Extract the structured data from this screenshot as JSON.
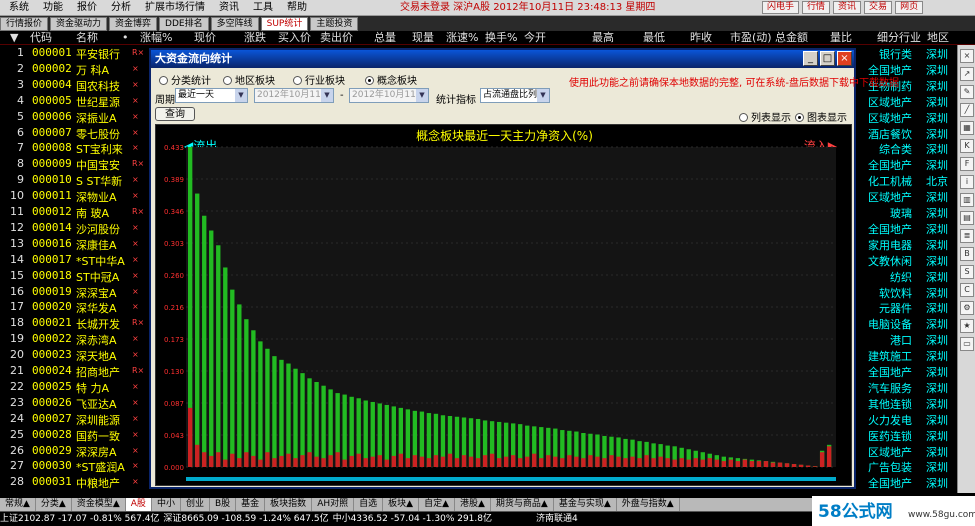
{
  "menubar": {
    "items": [
      "系统",
      "功能",
      "报价",
      "分析",
      "扩展市场行情",
      "资讯",
      "工具",
      "帮助"
    ],
    "status": "交易未登录  深沪A股  2012年10月11日  23:48:13  星期四",
    "buttons": [
      "闪电手",
      "行情",
      "资讯",
      "交易",
      "网页"
    ],
    "site": "www.55188.com"
  },
  "tabs": [
    "行情报价",
    "资金驱动力",
    "资金博弈",
    "DDE排名",
    "多空阵线",
    "SUP统计",
    "主题投资"
  ],
  "active_tab": 5,
  "list_header": {
    "cols": [
      "代码",
      "名称",
      "•",
      "涨幅%",
      "现价",
      "涨跌",
      "买入价",
      "卖出价",
      "总量",
      "现量",
      "涨速%",
      "换手%",
      "今开",
      "最高",
      "最低",
      "昨收",
      "市盈(动)",
      "总金额",
      "量比",
      "细分行业",
      "地区"
    ]
  },
  "stocks": [
    {
      "n": "1",
      "code": "000001",
      "name": "平安银行",
      "flag": "R×"
    },
    {
      "n": "2",
      "code": "000002",
      "name": "万 科A",
      "flag": "×"
    },
    {
      "n": "3",
      "code": "000004",
      "name": "国农科技",
      "flag": "×"
    },
    {
      "n": "4",
      "code": "000005",
      "name": "世纪星源",
      "flag": "×"
    },
    {
      "n": "5",
      "code": "000006",
      "name": "深振业A",
      "flag": "×"
    },
    {
      "n": "6",
      "code": "000007",
      "name": "零七股份",
      "flag": "×"
    },
    {
      "n": "7",
      "code": "000008",
      "name": "ST宝利来",
      "flag": "×"
    },
    {
      "n": "8",
      "code": "000009",
      "name": "中国宝安",
      "flag": "R×"
    },
    {
      "n": "9",
      "code": "000010",
      "name": "S ST华新",
      "flag": "×"
    },
    {
      "n": "10",
      "code": "000011",
      "name": "深物业A",
      "flag": "×"
    },
    {
      "n": "11",
      "code": "000012",
      "name": "南 玻A",
      "flag": "R×"
    },
    {
      "n": "12",
      "code": "000014",
      "name": "沙河股份",
      "flag": "×"
    },
    {
      "n": "13",
      "code": "000016",
      "name": "深康佳A",
      "flag": "×"
    },
    {
      "n": "14",
      "code": "000017",
      "name": "*ST中华A",
      "flag": "×"
    },
    {
      "n": "15",
      "code": "000018",
      "name": "ST中冠A",
      "flag": "×"
    },
    {
      "n": "16",
      "code": "000019",
      "name": "深深宝A",
      "flag": "×"
    },
    {
      "n": "17",
      "code": "000020",
      "name": "深华发A",
      "flag": "×"
    },
    {
      "n": "18",
      "code": "000021",
      "name": "长城开发",
      "flag": "R×"
    },
    {
      "n": "19",
      "code": "000022",
      "name": "深赤湾A",
      "flag": "×"
    },
    {
      "n": "20",
      "code": "000023",
      "name": "深天地A",
      "flag": "×"
    },
    {
      "n": "21",
      "code": "000024",
      "name": "招商地产",
      "flag": "R×"
    },
    {
      "n": "22",
      "code": "000025",
      "name": "特 力A",
      "flag": "×"
    },
    {
      "n": "23",
      "code": "000026",
      "name": "飞亚达A",
      "flag": "×"
    },
    {
      "n": "24",
      "code": "000027",
      "name": "深圳能源",
      "flag": "×"
    },
    {
      "n": "25",
      "code": "000028",
      "name": "国药一致",
      "flag": "×"
    },
    {
      "n": "26",
      "code": "000029",
      "name": "深深房A",
      "flag": "×"
    },
    {
      "n": "27",
      "code": "000030",
      "name": "*ST盛润A",
      "flag": "×"
    },
    {
      "n": "28",
      "code": "000031",
      "name": "中粮地产",
      "flag": "×"
    }
  ],
  "right_rows": [
    {
      "ind": "银行类",
      "reg": "深圳"
    },
    {
      "ind": "全国地产",
      "reg": "深圳"
    },
    {
      "ind": "生物制药",
      "reg": "深圳"
    },
    {
      "ind": "区域地产",
      "reg": "深圳"
    },
    {
      "ind": "区域地产",
      "reg": "深圳"
    },
    {
      "ind": "酒店餐饮",
      "reg": "深圳"
    },
    {
      "ind": "综合类",
      "reg": "深圳"
    },
    {
      "ind": "全国地产",
      "reg": "深圳"
    },
    {
      "ind": "化工机械",
      "reg": "北京"
    },
    {
      "ind": "区域地产",
      "reg": "深圳"
    },
    {
      "ind": "玻璃",
      "reg": "深圳"
    },
    {
      "ind": "全国地产",
      "reg": "深圳"
    },
    {
      "ind": "家用电器",
      "reg": "深圳"
    },
    {
      "ind": "文教休闲",
      "reg": "深圳"
    },
    {
      "ind": "纺织",
      "reg": "深圳"
    },
    {
      "ind": "软饮料",
      "reg": "深圳"
    },
    {
      "ind": "元器件",
      "reg": "深圳"
    },
    {
      "ind": "电脑设备",
      "reg": "深圳"
    },
    {
      "ind": "港口",
      "reg": "深圳"
    },
    {
      "ind": "建筑施工",
      "reg": "深圳"
    },
    {
      "ind": "全国地产",
      "reg": "深圳"
    },
    {
      "ind": "汽车服务",
      "reg": "深圳"
    },
    {
      "ind": "其他连锁",
      "reg": "深圳"
    },
    {
      "ind": "火力发电",
      "reg": "深圳"
    },
    {
      "ind": "医药连锁",
      "reg": "深圳"
    },
    {
      "ind": "区域地产",
      "reg": "深圳"
    },
    {
      "ind": "广告包装",
      "reg": "深圳"
    },
    {
      "ind": "全国地产",
      "reg": "深圳"
    }
  ],
  "dialog": {
    "title": "大资金流向统计",
    "radios": [
      "分类统计",
      "地区板块",
      "行业板块",
      "概念板块"
    ],
    "selected_radio": 3,
    "warning": "使用此功能之前请确保本地数据的完整, 可在系统-盘后数据下载中下载数据",
    "period_label": "周期",
    "period_value": "最近一天",
    "date_from": "2012年10月11日",
    "date_sep": "-",
    "date_to": "2012年10月11日",
    "metric_label": "统计指标",
    "metric_value": "占流通盘比列",
    "query_label": "查询",
    "view_list": "列表显示",
    "view_chart": "图表显示",
    "selected_view": "图表显示"
  },
  "chart_data": {
    "type": "bar",
    "title": "概念板块最近一天主力净资入(%)",
    "left_label": "流出",
    "right_label": "流入",
    "yticks": [
      "0.433",
      "0.389",
      "0.346",
      "0.303",
      "0.260",
      "0.216",
      "0.173",
      "0.130",
      "0.087",
      "0.043",
      "0.000"
    ],
    "ylim": [
      0,
      0.433
    ],
    "series": [
      {
        "values": [
          0.433,
          0.37,
          0.34,
          0.32,
          0.3,
          0.27,
          0.24,
          0.22,
          0.2,
          0.185,
          0.17,
          0.16,
          0.15,
          0.145,
          0.14,
          0.133,
          0.127,
          0.12,
          0.115,
          0.11,
          0.105,
          0.1,
          0.098,
          0.095,
          0.093,
          0.09,
          0.088,
          0.086,
          0.084,
          0.082,
          0.08,
          0.078,
          0.076,
          0.075,
          0.073,
          0.072,
          0.07,
          0.069,
          0.068,
          0.067,
          0.066,
          0.065,
          0.063,
          0.062,
          0.061,
          0.06,
          0.059,
          0.058,
          0.056,
          0.055,
          0.054,
          0.053,
          0.052,
          0.05,
          0.049,
          0.048,
          0.046,
          0.045,
          0.044,
          0.042,
          0.041,
          0.04,
          0.038,
          0.037,
          0.035,
          0.034,
          0.032,
          0.031,
          0.029,
          0.028,
          0.026,
          0.024,
          0.022,
          0.02,
          0.018,
          0.016,
          0.014,
          0.013,
          0.012,
          0.011,
          0.01,
          0.009,
          0.008,
          0.007,
          0.006,
          0.005,
          0.004,
          0.003,
          0.002,
          0.001,
          0.022,
          0.03
        ]
      },
      {
        "values": [
          0.08,
          0.03,
          0.02,
          0.015,
          0.02,
          0.01,
          0.018,
          0.012,
          0.02,
          0.015,
          0.01,
          0.02,
          0.012,
          0.015,
          0.018,
          0.012,
          0.016,
          0.02,
          0.014,
          0.012,
          0.016,
          0.02,
          0.01,
          0.015,
          0.018,
          0.012,
          0.014,
          0.016,
          0.01,
          0.015,
          0.018,
          0.012,
          0.016,
          0.014,
          0.012,
          0.016,
          0.014,
          0.018,
          0.012,
          0.016,
          0.014,
          0.012,
          0.016,
          0.018,
          0.012,
          0.014,
          0.016,
          0.012,
          0.014,
          0.018,
          0.012,
          0.016,
          0.014,
          0.012,
          0.016,
          0.014,
          0.012,
          0.016,
          0.014,
          0.012,
          0.016,
          0.014,
          0.012,
          0.014,
          0.012,
          0.016,
          0.012,
          0.014,
          0.012,
          0.01,
          0.012,
          0.01,
          0.012,
          0.01,
          0.012,
          0.01,
          0.008,
          0.01,
          0.008,
          0.01,
          0.008,
          0.008,
          0.008,
          0.006,
          0.006,
          0.005,
          0.004,
          0.003,
          0.002,
          0.001,
          0.02,
          0.028
        ]
      }
    ]
  },
  "bottom_tabs": [
    "常规▲",
    "分类▲",
    "资金模型▲",
    "A股",
    "中小",
    "创业",
    "B股",
    "基金",
    "板块指数",
    "AH对照",
    "自选",
    "板块▲",
    "自定▲",
    "港股▲",
    "期货与商品▲",
    "基金与实现▲",
    "外盘与指数▲"
  ],
  "status": {
    "sh": "上证2102.87  -17.07  -0.81%  567.4亿",
    "sz": "深证8665.09  -108.59  -1.24%  647.5亿",
    "zx": "中小4336.52  -57.04  -1.30%  291.8亿",
    "srv": "济南联通4"
  },
  "watermark": {
    "text": "58公式网",
    "url": "www.58gu.com"
  }
}
